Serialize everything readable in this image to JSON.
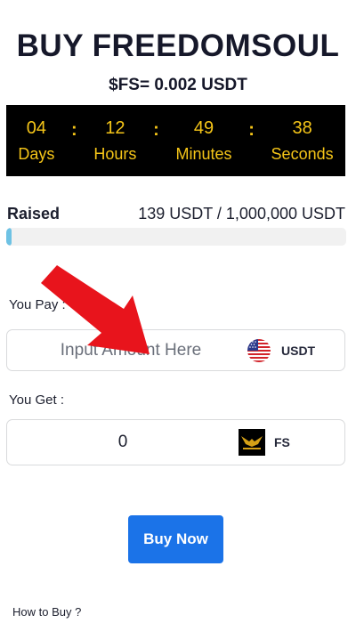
{
  "header": {
    "title": "BUY FREEDOMSOUL",
    "price": "$FS= 0.002 USDT"
  },
  "countdown": {
    "days": "04",
    "days_label": "Days",
    "hours": "12",
    "hours_label": "Hours",
    "minutes": "49",
    "minutes_label": "Minutes",
    "seconds": "38",
    "seconds_label": "Seconds",
    "separator": ":"
  },
  "raised": {
    "label": "Raised",
    "value": "139 USDT / 1,000,000 USDT",
    "progress_percent": 0.0139
  },
  "pay": {
    "label": "You Pay :",
    "placeholder": "Input Amount Here",
    "currency": "USDT",
    "currency_icon": "us-flag-icon"
  },
  "get": {
    "label": "You Get :",
    "value": "0",
    "currency": "FS",
    "currency_icon": "freedomsoul-logo-icon"
  },
  "buy_button": "Buy Now",
  "how_to_buy": "How to Buy ?",
  "colors": {
    "accent": "#1b73e8",
    "countdown_text": "#f5c518",
    "progress": "#6ec2e4",
    "annotation_arrow": "#e8141c"
  }
}
